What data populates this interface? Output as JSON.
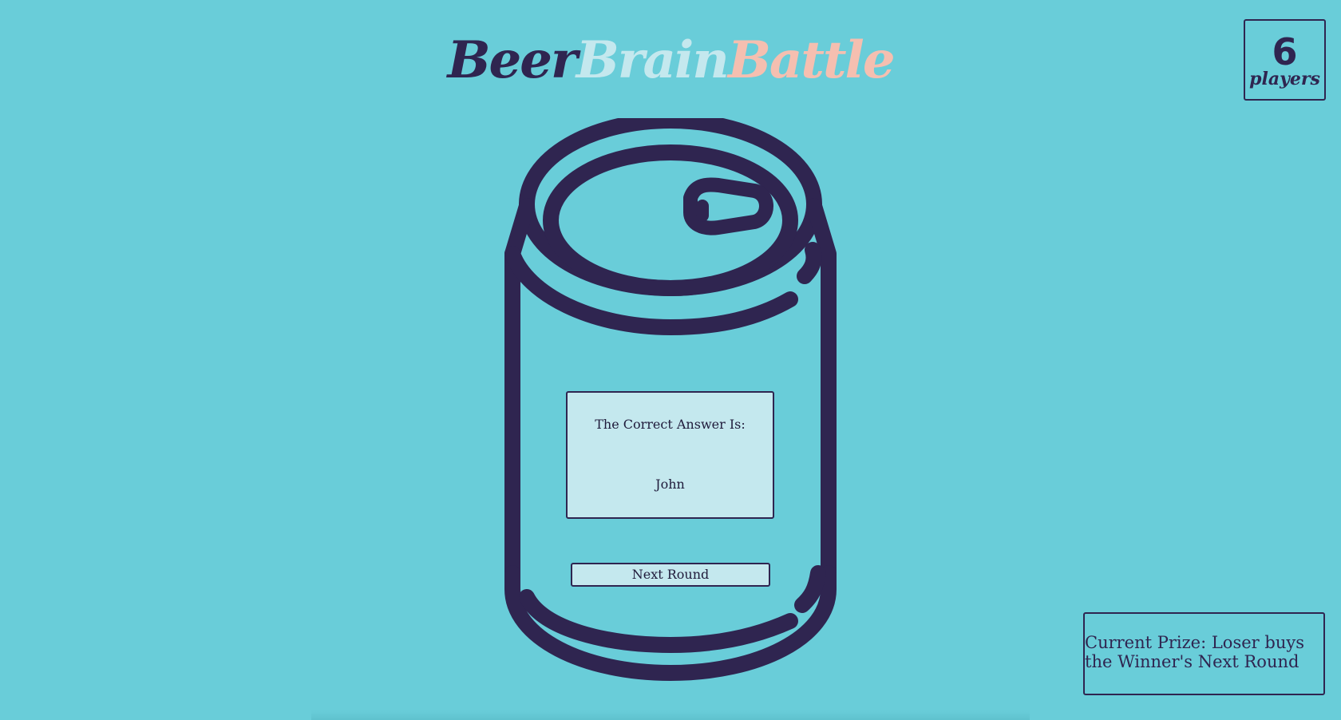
{
  "logo": {
    "word1": "Beer",
    "word2": "Brain",
    "word3": "Battle"
  },
  "players": {
    "count": "6",
    "label": "players"
  },
  "answer": {
    "heading": "The Correct Answer Is:",
    "value": "John"
  },
  "next_button": {
    "label": "Next Round"
  },
  "prize": {
    "text": "Current Prize: Loser buys the Winner's Next Round"
  },
  "colors": {
    "background": "#69cdd9",
    "ink": "#2f2550",
    "logo_word1": "#2f2550",
    "logo_word2": "#c4e8ee",
    "logo_word3": "#f5bfb0",
    "card_fill": "#c4e8ee"
  },
  "icons": {
    "can": "beer-can-icon"
  }
}
